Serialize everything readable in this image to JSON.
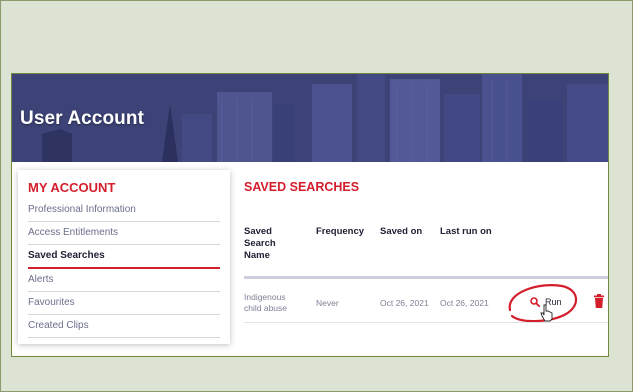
{
  "banner": {
    "title": "User Account"
  },
  "sidebar": {
    "title": "MY ACCOUNT",
    "items": [
      {
        "label": "Professional Information"
      },
      {
        "label": "Access Entitlements"
      },
      {
        "label": "Saved Searches",
        "active": true
      },
      {
        "label": "Alerts"
      },
      {
        "label": "Favourites"
      },
      {
        "label": "Created Clips"
      }
    ]
  },
  "main": {
    "title": "SAVED SEARCHES",
    "columns": [
      "Saved Search Name",
      "Frequency",
      "Saved on",
      "Last run on"
    ],
    "column_lines": [
      [
        "Saved",
        "Search",
        "Name"
      ]
    ],
    "rows": [
      {
        "name_lines": [
          "Indigenous",
          "child abuse"
        ],
        "frequency": "Never",
        "saved_on": "Oct 26, 2021",
        "last_run_on": "Oct 26, 2021",
        "run_label": "Run"
      }
    ]
  },
  "colors": {
    "accent": "#d41e2c",
    "banner": "#3d4478",
    "background": "#dde3d2"
  },
  "icons": {
    "run": "search-icon",
    "delete": "trash-icon",
    "cursor": "hand-pointer-icon",
    "annotation": "red-circle-annotation"
  }
}
